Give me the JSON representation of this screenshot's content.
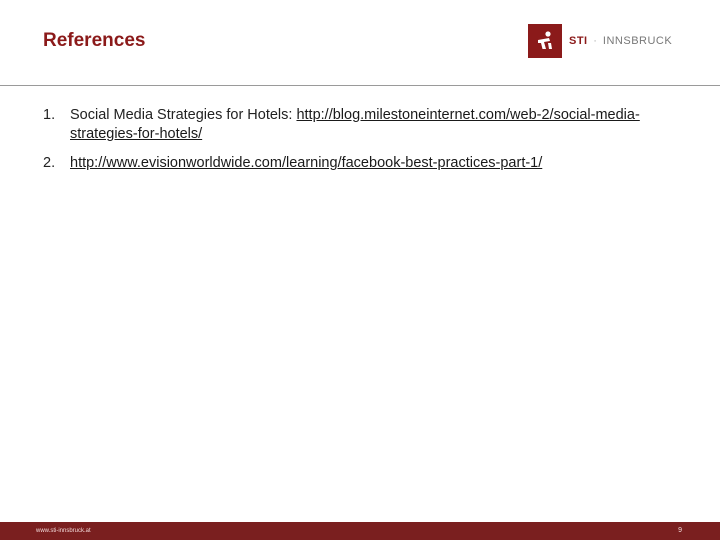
{
  "header": {
    "title": "References",
    "logo": {
      "brand": "STI",
      "separator": "·",
      "location": "INNSBRUCK",
      "color": "#8b1a1a",
      "icon": "sti-figure-icon"
    }
  },
  "references": [
    {
      "number": "1.",
      "text": "Social Media Strategies for Hotels: ",
      "link": "http://blog.milestoneinternet.com/web-2/social-media-strategies-for-hotels/"
    },
    {
      "number": "2.",
      "text": "",
      "link": "http://www.evisionworldwide.com/learning/facebook-best-practices-part-1/"
    }
  ],
  "footer": {
    "url": "www.sti-innsbruck.at",
    "page": "9",
    "color": "#7a1f1f"
  }
}
